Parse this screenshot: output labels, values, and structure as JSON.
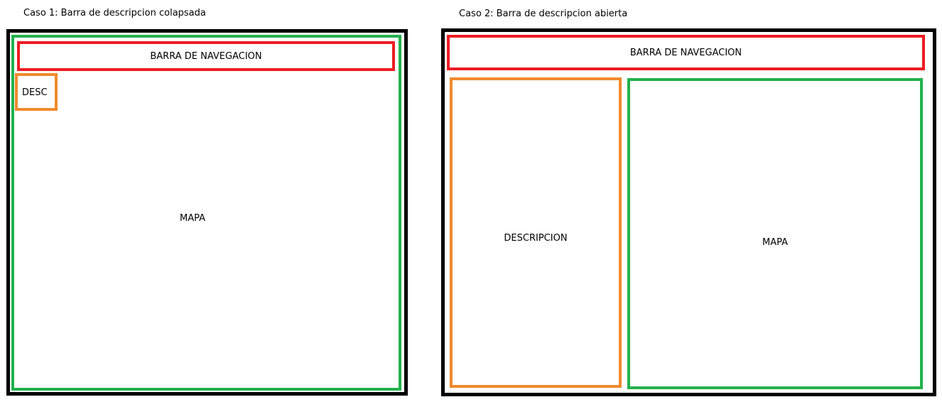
{
  "colors": {
    "outline": "#000000",
    "map": "#22b14c",
    "navbar": "#ed1c24",
    "description": "#f08a2c"
  },
  "case1": {
    "caption": "Caso 1: Barra de descripcion colapsada",
    "navbar_label": "BARRA DE NAVEGACION",
    "desc_label": "DESC",
    "map_label": "MAPA"
  },
  "case2": {
    "caption": "Caso 2: Barra de descripcion abierta",
    "navbar_label": "BARRA DE NAVEGACION",
    "desc_label": "DESCRIPCION",
    "map_label": "MAPA"
  }
}
